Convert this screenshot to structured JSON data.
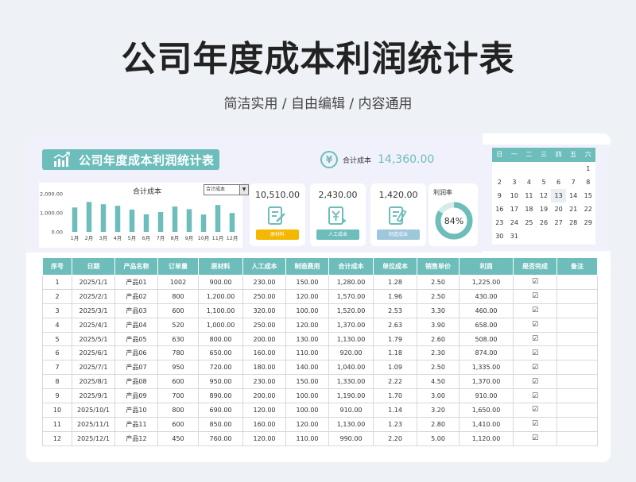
{
  "header": {
    "title": "公司年度成本利润统计表",
    "subtitle": "简洁实用 / 自由编辑 / 内容通用"
  },
  "banner": {
    "title": "公司年度成本利润统计表"
  },
  "total": {
    "icon": "yen-icon",
    "label": "合计成本",
    "value": "14,360.00"
  },
  "chart_data": {
    "type": "bar",
    "title": "合计成本",
    "categories": [
      "1月",
      "2月",
      "3月",
      "4月",
      "5月",
      "6月",
      "7月",
      "8月",
      "9月",
      "10月",
      "11月",
      "12月"
    ],
    "values": [
      1280,
      1570,
      1450,
      1370,
      1170,
      920,
      1040,
      1330,
      1190,
      910,
      1410,
      990
    ],
    "yticks": [
      "2,000.00",
      "1,000.00",
      "0.00"
    ],
    "ylim": [
      0,
      2000
    ],
    "color": "#6dbdba",
    "selector": "合计成本"
  },
  "kpis": [
    {
      "value": "10,510.00",
      "label": "原材料",
      "color": "#f5b800",
      "icon": "document-edit-icon"
    },
    {
      "value": "2,430.00",
      "label": "人工成本",
      "color": "#6dbdba",
      "icon": "yen-transfer-icon"
    },
    {
      "value": "1,420.00",
      "label": "制造成本",
      "color": "#9fc7dc",
      "icon": "document-pen-icon"
    }
  ],
  "profit": {
    "label": "利润率",
    "value": "84%",
    "ratio": 0.84
  },
  "calendar": {
    "weekdays": [
      "日",
      "一",
      "二",
      "三",
      "四",
      "五",
      "六"
    ],
    "weeks": [
      [
        "",
        "",
        "",
        "",
        "",
        "",
        "1"
      ],
      [
        "2",
        "3",
        "4",
        "5",
        "6",
        "7",
        "8"
      ],
      [
        "9",
        "10",
        "11",
        "12",
        "13",
        "14",
        "15"
      ],
      [
        "16",
        "17",
        "18",
        "19",
        "20",
        "21",
        "22"
      ],
      [
        "23",
        "24",
        "25",
        "26",
        "27",
        "28",
        "29"
      ],
      [
        "30",
        "31",
        "",
        "",
        "",
        "",
        ""
      ]
    ],
    "today": "13"
  },
  "table": {
    "columns": [
      "序号",
      "日期",
      "产品名称",
      "订单量",
      "原材料",
      "人工成本",
      "制造费用",
      "合计成本",
      "单位成本",
      "销售单价",
      "利润",
      "是否完成",
      "备注"
    ],
    "rows": [
      [
        "1",
        "2025/1/1",
        "产品01",
        "1002",
        "900.00",
        "230.00",
        "150.00",
        "1,280.00",
        "1.28",
        "2.50",
        "1,225.00",
        "☑",
        ""
      ],
      [
        "2",
        "2025/2/1",
        "产品02",
        "800",
        "1,200.00",
        "250.00",
        "120.00",
        "1,570.00",
        "1.96",
        "2.50",
        "430.00",
        "☑",
        ""
      ],
      [
        "3",
        "2025/3/1",
        "产品03",
        "600",
        "1,100.00",
        "320.00",
        "100.00",
        "1,520.00",
        "2.53",
        "3.30",
        "460.00",
        "☑",
        ""
      ],
      [
        "4",
        "2025/4/1",
        "产品04",
        "520",
        "1,000.00",
        "250.00",
        "120.00",
        "1,370.00",
        "2.63",
        "3.90",
        "658.00",
        "☑",
        ""
      ],
      [
        "5",
        "2025/5/1",
        "产品05",
        "630",
        "800.00",
        "200.00",
        "130.00",
        "1,130.00",
        "1.79",
        "2.60",
        "508.00",
        "☑",
        ""
      ],
      [
        "6",
        "2025/6/1",
        "产品06",
        "780",
        "650.00",
        "160.00",
        "110.00",
        "920.00",
        "1.18",
        "2.30",
        "874.00",
        "☑",
        ""
      ],
      [
        "7",
        "2025/7/1",
        "产品07",
        "950",
        "720.00",
        "180.00",
        "140.00",
        "1,040.00",
        "1.09",
        "2.50",
        "1,335.00",
        "☑",
        ""
      ],
      [
        "8",
        "2025/8/1",
        "产品08",
        "600",
        "950.00",
        "230.00",
        "150.00",
        "1,330.00",
        "2.22",
        "4.50",
        "1,370.00",
        "☑",
        ""
      ],
      [
        "9",
        "2025/9/1",
        "产品09",
        "700",
        "890.00",
        "200.00",
        "100.00",
        "1,190.00",
        "1.70",
        "3.00",
        "910.00",
        "☑",
        ""
      ],
      [
        "10",
        "2025/10/1",
        "产品10",
        "800",
        "690.00",
        "120.00",
        "100.00",
        "910.00",
        "1.14",
        "3.20",
        "1,650.00",
        "☑",
        ""
      ],
      [
        "11",
        "2025/11/1",
        "产品11",
        "600",
        "850.00",
        "160.00",
        "120.00",
        "1,130.00",
        "1.23",
        "2.80",
        "1,410.00",
        "☑",
        ""
      ],
      [
        "12",
        "2025/12/1",
        "产品12",
        "450",
        "760.00",
        "120.00",
        "110.00",
        "990.00",
        "2.20",
        "5.00",
        "1,120.00",
        "☑",
        ""
      ]
    ]
  }
}
